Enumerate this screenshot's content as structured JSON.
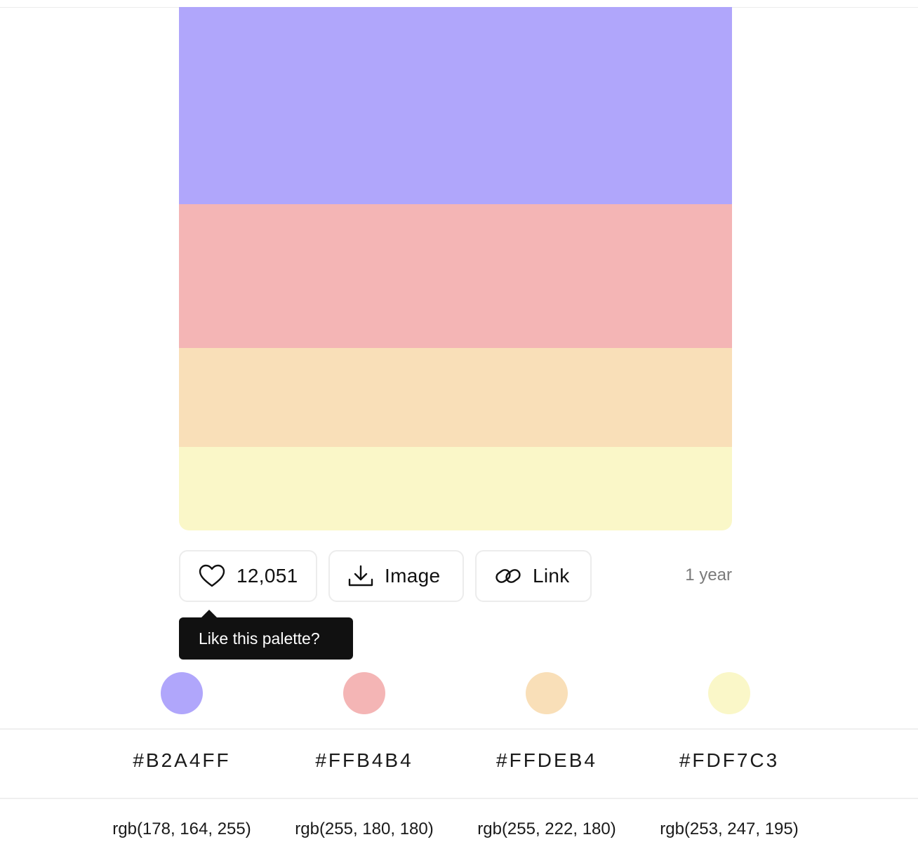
{
  "palette": {
    "colors": [
      {
        "hex": "#B2A4FF",
        "rgb": "rgb(178, 164, 255)",
        "swatch": "#B0A6FB"
      },
      {
        "hex": "#FFB4B4",
        "rgb": "rgb(255, 180, 180)",
        "swatch": "#F4B5B5"
      },
      {
        "hex": "#FFDEB4",
        "rgb": "rgb(255, 222, 180)",
        "swatch": "#F9DFB8"
      },
      {
        "hex": "#FDF7C3",
        "rgb": "rgb(253, 247, 195)",
        "swatch": "#FAF7C8"
      }
    ]
  },
  "actions": {
    "like_count": "12,051",
    "like_icon": "heart-icon",
    "image_label": "Image",
    "image_icon": "download-icon",
    "link_label": "Link",
    "link_icon": "link-icon",
    "age": "1 year"
  },
  "tooltip": {
    "text": "Like this palette?"
  }
}
